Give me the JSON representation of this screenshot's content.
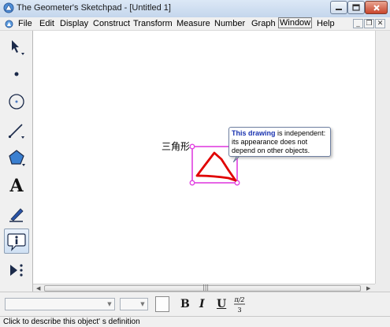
{
  "window": {
    "title": "The Geometer's Sketchpad - [Untitled 1]"
  },
  "menubar": {
    "items": [
      "File",
      "Edit",
      "Display",
      "Construct",
      "Transform",
      "Measure",
      "Number",
      "Graph",
      "Window",
      "Help"
    ],
    "active_item": "Window"
  },
  "toolbox": {
    "tools": [
      {
        "name": "arrow-tool",
        "icon": "arrow-icon"
      },
      {
        "name": "point-tool",
        "icon": "point-icon"
      },
      {
        "name": "compass-tool",
        "icon": "compass-icon"
      },
      {
        "name": "straightedge-tool",
        "icon": "straightedge-icon"
      },
      {
        "name": "polygon-tool",
        "icon": "polygon-icon"
      },
      {
        "name": "text-tool",
        "icon": "text-icon",
        "glyph": "A"
      },
      {
        "name": "marker-tool",
        "icon": "marker-icon"
      },
      {
        "name": "information-tool",
        "icon": "info-icon",
        "selected": true
      },
      {
        "name": "custom-tools",
        "icon": "custom-tools-icon"
      }
    ]
  },
  "canvas": {
    "label": "三角形",
    "tooltip": {
      "bold_text": "This drawing",
      "rest_text": " is independent: its appearance does not depend on other objects."
    },
    "colors": {
      "selection_box": "#e040e0",
      "drawing_stroke": "#e00000"
    }
  },
  "textbar": {
    "bold": "B",
    "italic": "I",
    "underline": "U",
    "math_format": "π/2 / 3"
  },
  "status": {
    "text": "Click to describe this object' s definition"
  },
  "colors": {
    "accent": "#1a33b0",
    "close_button": "#c8452c"
  }
}
